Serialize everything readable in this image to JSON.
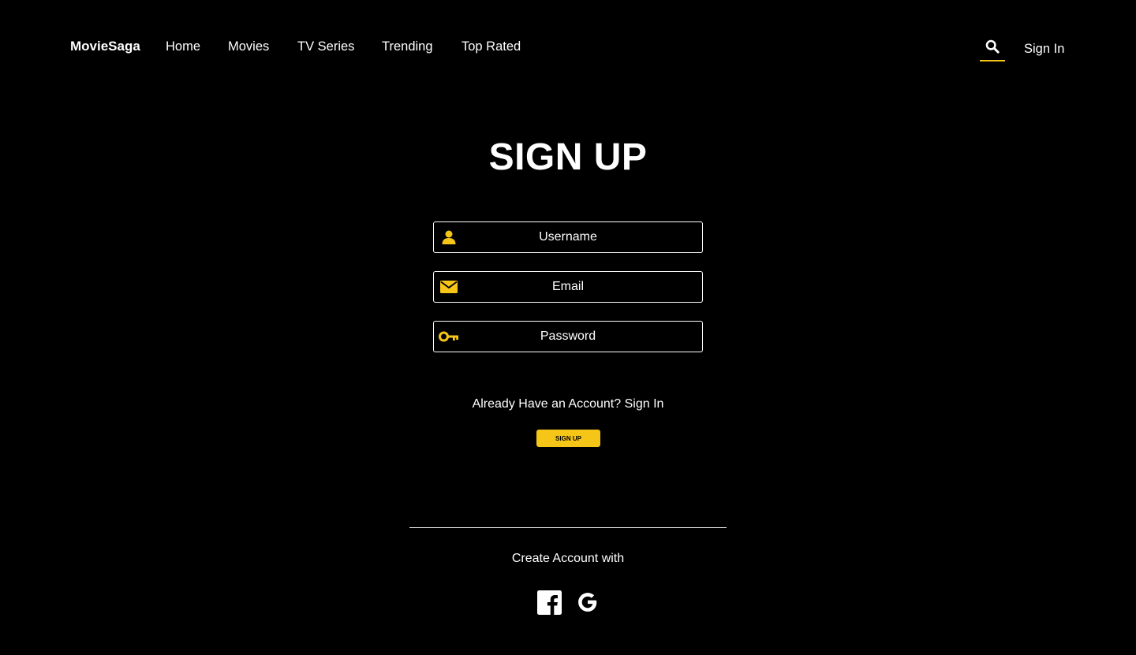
{
  "header": {
    "brand": "MovieSaga",
    "nav": [
      {
        "label": "Home"
      },
      {
        "label": "Movies"
      },
      {
        "label": "TV Series"
      },
      {
        "label": "Trending"
      },
      {
        "label": "Top Rated"
      }
    ],
    "search_icon": "search-icon",
    "signin_label": "Sign In"
  },
  "form": {
    "title": "SIGN UP",
    "username_placeholder": "Username",
    "email_placeholder": "Email",
    "password_placeholder": "Password",
    "have_account_text": "Already Have an Account?",
    "have_account_link": "Sign In",
    "submit_label": "SIGN UP"
  },
  "social": {
    "heading": "Create Account with",
    "providers": [
      {
        "name": "Facebook",
        "icon": "facebook-icon"
      },
      {
        "name": "Google",
        "icon": "google-icon"
      }
    ]
  },
  "colors": {
    "background": "#000000",
    "text": "#ffffff",
    "accent": "#f5c518"
  }
}
